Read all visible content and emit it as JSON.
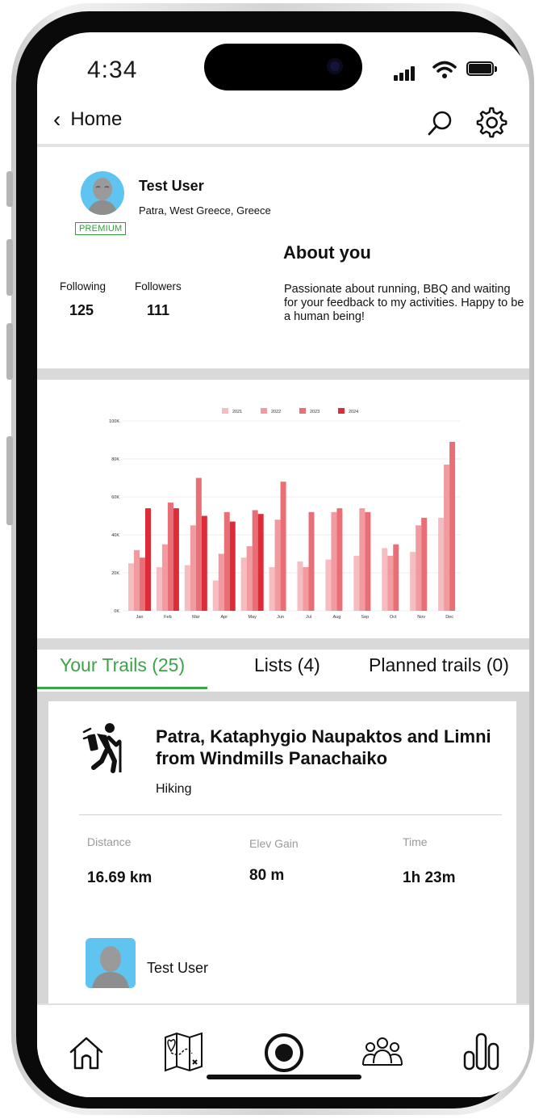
{
  "status_bar": {
    "time": "4:34"
  },
  "header": {
    "back_label": "Home",
    "icons": [
      "search-icon",
      "gear-icon"
    ]
  },
  "profile": {
    "name": "Test User",
    "location": "Patra, West Greece, Greece",
    "badge": "PREMIUM",
    "following_label": "Following",
    "following_count": "125",
    "followers_label": "Followers",
    "followers_count": "111",
    "about_title": "About you",
    "about_text": "Passionate about running, BBQ and waiting for your feedback to my activities. Happy to be a human being!"
  },
  "chart_data": {
    "type": "bar",
    "categories": [
      "Jan",
      "Feb",
      "Mar",
      "Apr",
      "May",
      "Jun",
      "Jul",
      "Aug",
      "Sep",
      "Oct",
      "Nov",
      "Dec"
    ],
    "series": [
      {
        "name": "2021",
        "values": [
          25000,
          23000,
          24000,
          16000,
          28000,
          23000,
          26000,
          27000,
          29000,
          33000,
          31000,
          49000
        ],
        "color": "#f6bcc0"
      },
      {
        "name": "2022",
        "values": [
          32000,
          35000,
          45000,
          30000,
          34000,
          48000,
          23000,
          52000,
          54000,
          29000,
          45000,
          77000
        ],
        "color": "#f19a9f"
      },
      {
        "name": "2023",
        "values": [
          28000,
          57000,
          70000,
          52000,
          53000,
          68000,
          52000,
          54000,
          52000,
          35000,
          49000,
          89000
        ],
        "color": "#e96f77"
      },
      {
        "name": "2024",
        "values": [
          54000,
          54000,
          50000,
          47000,
          51000,
          null,
          null,
          null,
          null,
          null,
          null,
          null
        ],
        "color": "#dc2c38"
      }
    ],
    "yticks": [
      "0K",
      "20K",
      "40K",
      "60K",
      "80K",
      "100K"
    ],
    "ylim": [
      0,
      100000
    ],
    "legend_position": "top-center",
    "grid": true
  },
  "tabs": [
    {
      "label": "Your Trails (25)",
      "active": true
    },
    {
      "label": "Lists (4)",
      "active": false
    },
    {
      "label": "Planned trails (0)",
      "active": false
    }
  ],
  "trail": {
    "icon": "hiker-icon",
    "title": "Patra, Kataphygio Naupaktos and Limni from Windmills Panachaiko",
    "type": "Hiking",
    "metrics": [
      {
        "label": "Distance",
        "value": "16.69 km"
      },
      {
        "label": "Elev Gain",
        "value": "80 m"
      },
      {
        "label": "Time",
        "value": "1h 23m"
      }
    ],
    "owner_name": "Test User"
  },
  "bottom_nav": [
    "home-icon",
    "map-icon",
    "record-icon",
    "community-icon",
    "stats-icon"
  ],
  "colors": {
    "accent_green": "#3aa447",
    "avatar_blue": "#5fc4ef"
  }
}
